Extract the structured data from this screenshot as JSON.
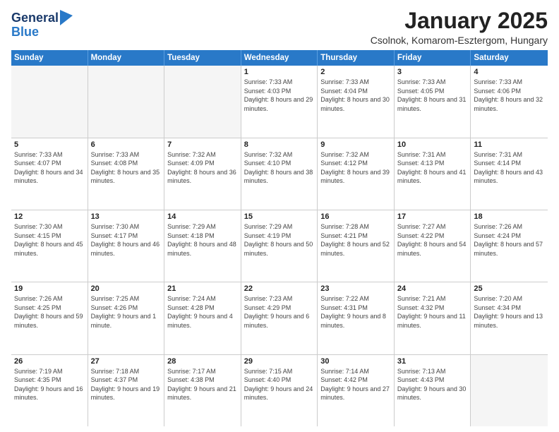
{
  "logo": {
    "general": "General",
    "blue": "Blue"
  },
  "header": {
    "month": "January 2025",
    "location": "Csolnok, Komarom-Esztergom, Hungary"
  },
  "days_of_week": [
    "Sunday",
    "Monday",
    "Tuesday",
    "Wednesday",
    "Thursday",
    "Friday",
    "Saturday"
  ],
  "weeks": [
    [
      {
        "day": "",
        "data": "",
        "empty": true
      },
      {
        "day": "",
        "data": "",
        "empty": true
      },
      {
        "day": "",
        "data": "",
        "empty": true
      },
      {
        "day": "1",
        "data": "Sunrise: 7:33 AM\nSunset: 4:03 PM\nDaylight: 8 hours and 29 minutes."
      },
      {
        "day": "2",
        "data": "Sunrise: 7:33 AM\nSunset: 4:04 PM\nDaylight: 8 hours and 30 minutes."
      },
      {
        "day": "3",
        "data": "Sunrise: 7:33 AM\nSunset: 4:05 PM\nDaylight: 8 hours and 31 minutes."
      },
      {
        "day": "4",
        "data": "Sunrise: 7:33 AM\nSunset: 4:06 PM\nDaylight: 8 hours and 32 minutes."
      }
    ],
    [
      {
        "day": "5",
        "data": "Sunrise: 7:33 AM\nSunset: 4:07 PM\nDaylight: 8 hours and 34 minutes."
      },
      {
        "day": "6",
        "data": "Sunrise: 7:33 AM\nSunset: 4:08 PM\nDaylight: 8 hours and 35 minutes."
      },
      {
        "day": "7",
        "data": "Sunrise: 7:32 AM\nSunset: 4:09 PM\nDaylight: 8 hours and 36 minutes."
      },
      {
        "day": "8",
        "data": "Sunrise: 7:32 AM\nSunset: 4:10 PM\nDaylight: 8 hours and 38 minutes."
      },
      {
        "day": "9",
        "data": "Sunrise: 7:32 AM\nSunset: 4:12 PM\nDaylight: 8 hours and 39 minutes."
      },
      {
        "day": "10",
        "data": "Sunrise: 7:31 AM\nSunset: 4:13 PM\nDaylight: 8 hours and 41 minutes."
      },
      {
        "day": "11",
        "data": "Sunrise: 7:31 AM\nSunset: 4:14 PM\nDaylight: 8 hours and 43 minutes."
      }
    ],
    [
      {
        "day": "12",
        "data": "Sunrise: 7:30 AM\nSunset: 4:15 PM\nDaylight: 8 hours and 45 minutes."
      },
      {
        "day": "13",
        "data": "Sunrise: 7:30 AM\nSunset: 4:17 PM\nDaylight: 8 hours and 46 minutes."
      },
      {
        "day": "14",
        "data": "Sunrise: 7:29 AM\nSunset: 4:18 PM\nDaylight: 8 hours and 48 minutes."
      },
      {
        "day": "15",
        "data": "Sunrise: 7:29 AM\nSunset: 4:19 PM\nDaylight: 8 hours and 50 minutes."
      },
      {
        "day": "16",
        "data": "Sunrise: 7:28 AM\nSunset: 4:21 PM\nDaylight: 8 hours and 52 minutes."
      },
      {
        "day": "17",
        "data": "Sunrise: 7:27 AM\nSunset: 4:22 PM\nDaylight: 8 hours and 54 minutes."
      },
      {
        "day": "18",
        "data": "Sunrise: 7:26 AM\nSunset: 4:24 PM\nDaylight: 8 hours and 57 minutes."
      }
    ],
    [
      {
        "day": "19",
        "data": "Sunrise: 7:26 AM\nSunset: 4:25 PM\nDaylight: 8 hours and 59 minutes."
      },
      {
        "day": "20",
        "data": "Sunrise: 7:25 AM\nSunset: 4:26 PM\nDaylight: 9 hours and 1 minute."
      },
      {
        "day": "21",
        "data": "Sunrise: 7:24 AM\nSunset: 4:28 PM\nDaylight: 9 hours and 4 minutes."
      },
      {
        "day": "22",
        "data": "Sunrise: 7:23 AM\nSunset: 4:29 PM\nDaylight: 9 hours and 6 minutes."
      },
      {
        "day": "23",
        "data": "Sunrise: 7:22 AM\nSunset: 4:31 PM\nDaylight: 9 hours and 8 minutes."
      },
      {
        "day": "24",
        "data": "Sunrise: 7:21 AM\nSunset: 4:32 PM\nDaylight: 9 hours and 11 minutes."
      },
      {
        "day": "25",
        "data": "Sunrise: 7:20 AM\nSunset: 4:34 PM\nDaylight: 9 hours and 13 minutes."
      }
    ],
    [
      {
        "day": "26",
        "data": "Sunrise: 7:19 AM\nSunset: 4:35 PM\nDaylight: 9 hours and 16 minutes."
      },
      {
        "day": "27",
        "data": "Sunrise: 7:18 AM\nSunset: 4:37 PM\nDaylight: 9 hours and 19 minutes."
      },
      {
        "day": "28",
        "data": "Sunrise: 7:17 AM\nSunset: 4:38 PM\nDaylight: 9 hours and 21 minutes."
      },
      {
        "day": "29",
        "data": "Sunrise: 7:15 AM\nSunset: 4:40 PM\nDaylight: 9 hours and 24 minutes."
      },
      {
        "day": "30",
        "data": "Sunrise: 7:14 AM\nSunset: 4:42 PM\nDaylight: 9 hours and 27 minutes."
      },
      {
        "day": "31",
        "data": "Sunrise: 7:13 AM\nSunset: 4:43 PM\nDaylight: 9 hours and 30 minutes."
      },
      {
        "day": "",
        "data": "",
        "empty": true
      }
    ]
  ]
}
